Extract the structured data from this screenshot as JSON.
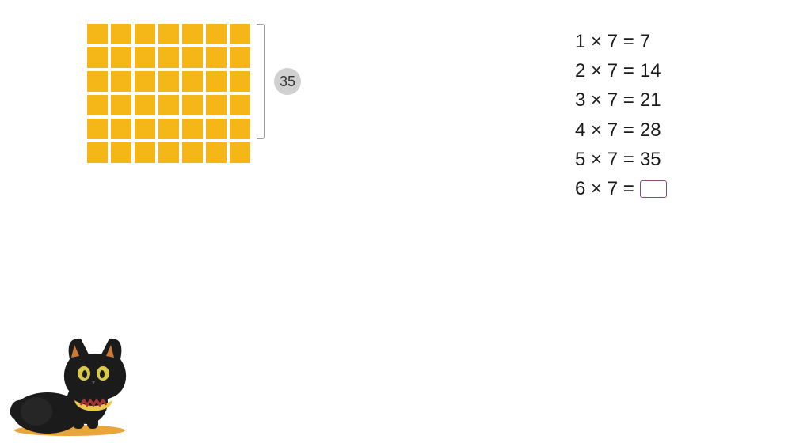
{
  "array": {
    "rows": 6,
    "cols": 7,
    "cell_color": "#f5b617",
    "bracket_label": "35"
  },
  "equations": [
    {
      "lhs": "1 × 7 =",
      "rhs": "7",
      "input": false
    },
    {
      "lhs": "2 × 7 =",
      "rhs": "14",
      "input": false
    },
    {
      "lhs": "3 × 7 =",
      "rhs": "21",
      "input": false
    },
    {
      "lhs": "4 × 7 =",
      "rhs": "28",
      "input": false
    },
    {
      "lhs": "5 × 7 =",
      "rhs": "35",
      "input": false
    },
    {
      "lhs": "6 × 7 =",
      "rhs": "",
      "input": true
    }
  ],
  "mascot": "black-cat"
}
